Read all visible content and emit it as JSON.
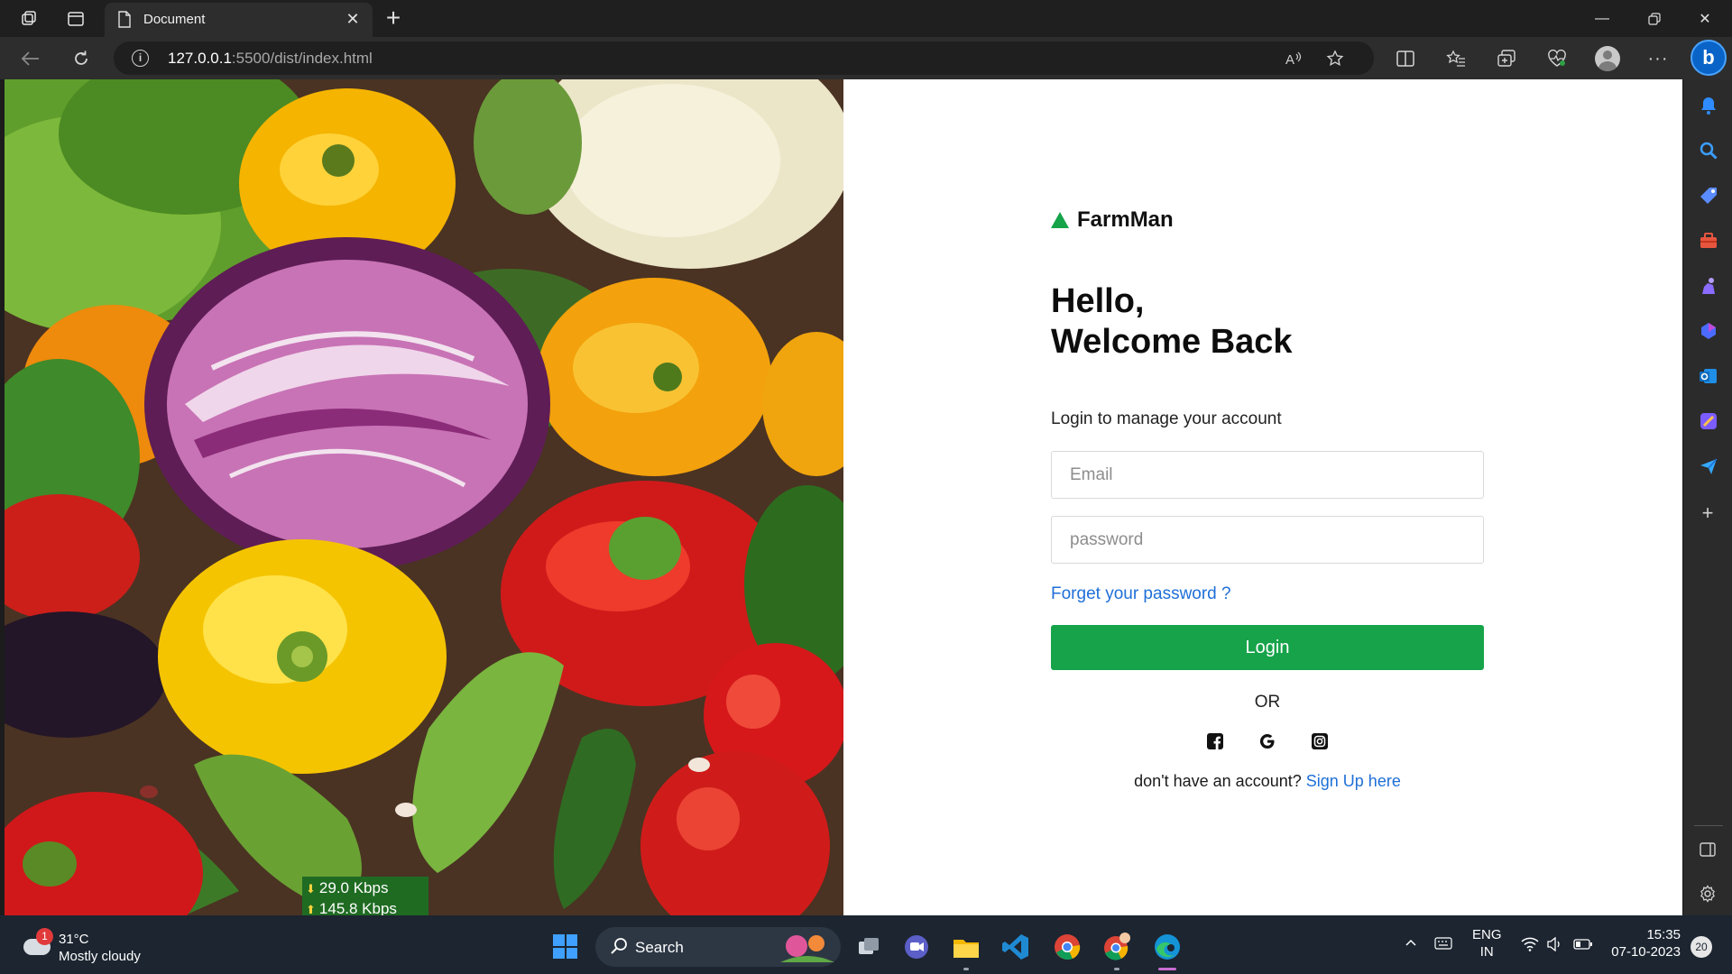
{
  "browser": {
    "tab_title": "Document",
    "url_host": "127.0.0.1",
    "url_path": ":5500/dist/index.html",
    "accent": "#0a64c8"
  },
  "page": {
    "brand": "FarmMan",
    "brand_color": "#16a34a",
    "greeting_line1": "Hello,",
    "greeting_line2": "Welcome Back",
    "subtitle": "Login to manage your account",
    "email_placeholder": "Email",
    "password_placeholder": "password",
    "forgot_link": "Forget your password ?",
    "login_button": "Login",
    "or_text": "OR",
    "social_icons": [
      "facebook-icon",
      "google-icon",
      "instagram-icon"
    ],
    "signup_prompt": "don't have an account?",
    "signup_link": "Sign Up here",
    "link_color": "#1f6fd8"
  },
  "overlay": {
    "download_speed": "29.0 Kbps",
    "upload_speed": "145.8 Kbps"
  },
  "taskbar": {
    "weather_badge": "1",
    "temperature": "31°C",
    "condition": "Mostly cloudy",
    "search_label": "Search",
    "lang_line1": "ENG",
    "lang_line2": "IN",
    "time": "15:35",
    "date": "07-10-2023",
    "notification_count": "20"
  }
}
